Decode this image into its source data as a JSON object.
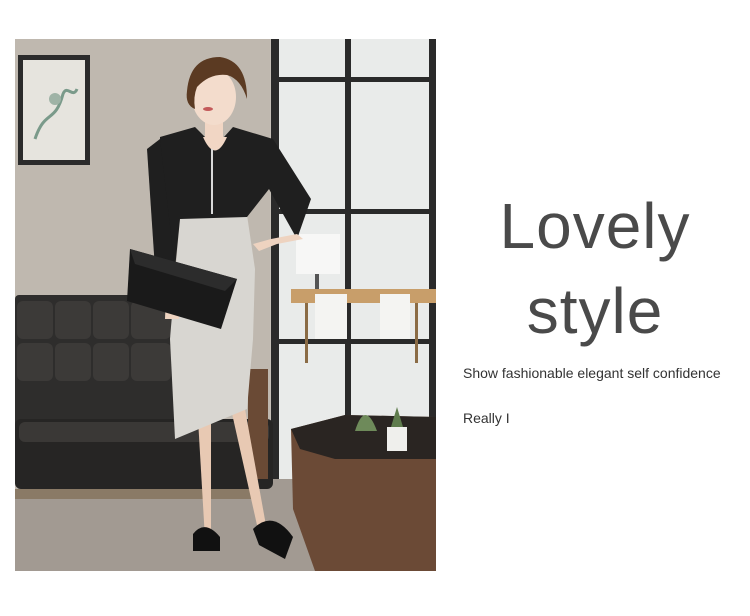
{
  "headline": {
    "line1": "Lovely",
    "line2": "style"
  },
  "description": "Show fashionable elegant self confidence",
  "tagline": "Really I",
  "colors": {
    "headline": "#4a4a4a",
    "text": "#333333",
    "background": "#ffffff"
  }
}
